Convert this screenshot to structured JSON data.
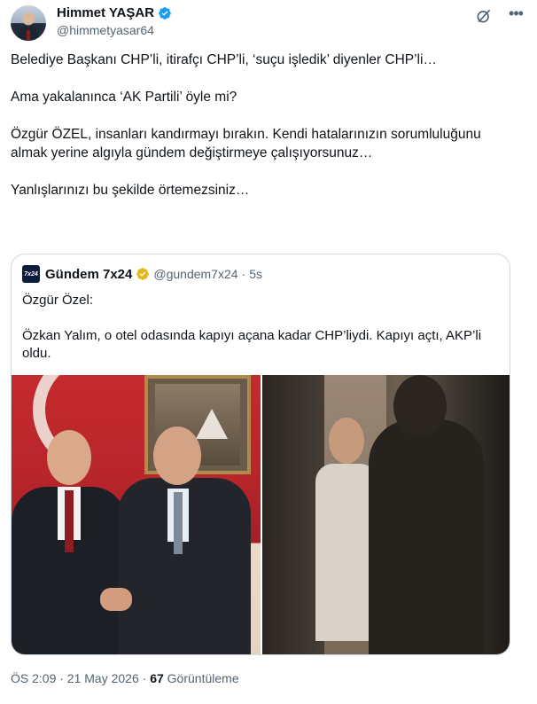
{
  "post": {
    "author_name": "Himmet YAŞAR",
    "author_handle": "@himmetyasar64",
    "paragraphs": [
      "Belediye Başkanı CHP’li, itirafçı CHP’li, ‘suçu işledik’ diyenler CHP’li…",
      "Ama yakalanınca ‘AK Partili’ öyle mi?",
      "Özgür ÖZEL, insanları kandırmayı bırakın. Kendi hatalarınızın sorumluluğunu almak yerine algıyla gündem değiştirmeye çalışıyorsunuz…",
      "Yanlışlarınızı bu şekilde örtemezsiniz…"
    ],
    "timestamp": "ÖS 2:09 · 21 May 2026 ·",
    "views_count": "67",
    "views_label": "Görüntüleme"
  },
  "quote": {
    "logo_text": "7x24",
    "author_name": "Gündem 7x24",
    "author_handle": "@gundem7x24",
    "separator": "·",
    "time": "5s",
    "paragraphs": [
      "Özgür Özel:",
      "Özkan Yalım, o otel odasında kapıyı açana kadar CHP’liydi. Kapıyı açtı, AKP’li oldu."
    ]
  },
  "icons": {
    "verified_blue": "verified-badge-icon",
    "verified_gold": "verified-gold-badge-icon",
    "grok": "grok-icon",
    "more": "more-icon"
  },
  "colors": {
    "text": "#0f1419",
    "secondary": "#536471",
    "verified_blue": "#1d9bf0",
    "verified_gold": "#e2b719",
    "border": "#cfd9de"
  }
}
